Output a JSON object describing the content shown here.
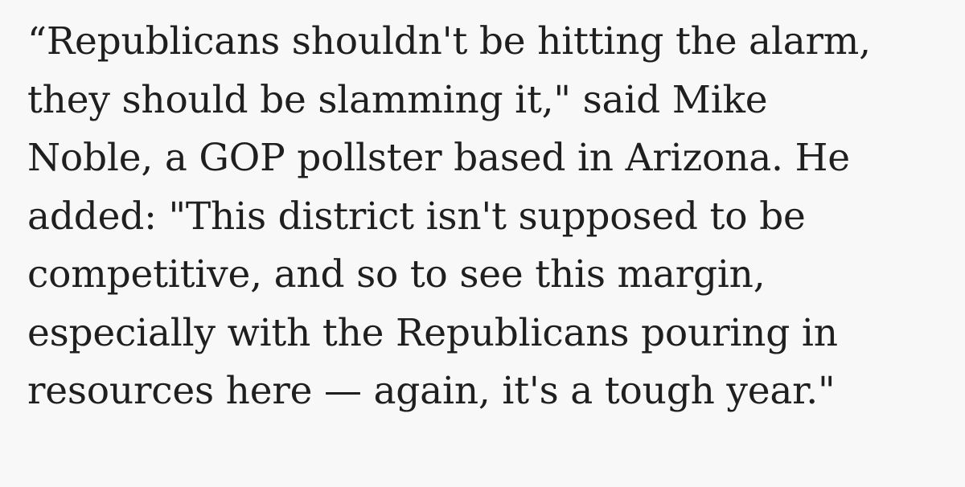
{
  "article": {
    "quote_lines": [
      "“Republicans shouldn't be hitting the alarm,",
      "they should be slamming it,\" said Mike",
      "Noble, a GOP pollster based in Arizona. He",
      "added: \"This district isn't supposed to be",
      "competitive, and so to see this margin,",
      "especially with the Republicans pouring in",
      "resources here — again, it's a tough year.\""
    ]
  }
}
